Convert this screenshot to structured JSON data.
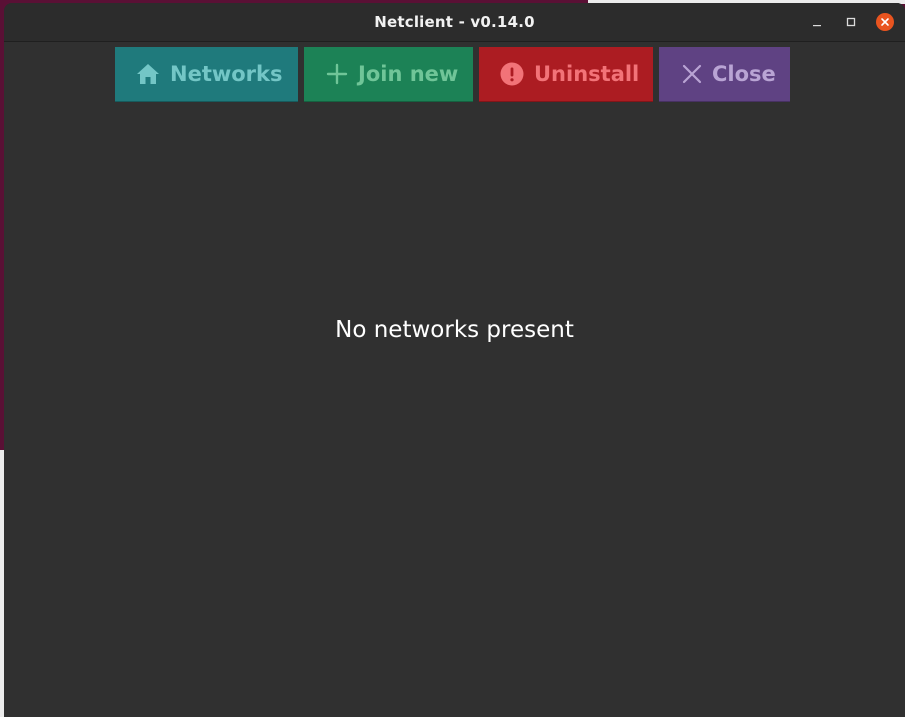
{
  "window": {
    "title": "Netclient - v0.14.0",
    "controls": {
      "minimize_icon": "minimize-icon",
      "maximize_icon": "maximize-icon",
      "close_icon": "close-icon",
      "close_color": "#e9541f"
    }
  },
  "toolbar": {
    "buttons": [
      {
        "label": "Networks",
        "icon": "home-icon",
        "bg": "#1f7a7c",
        "fg": "#73c6c6"
      },
      {
        "label": "Join new",
        "icon": "plus-icon",
        "bg": "#1c8256",
        "fg": "#70c598"
      },
      {
        "label": "Uninstall",
        "icon": "alert-circle-icon",
        "bg": "#ac1c22",
        "fg": "#f27378"
      },
      {
        "label": "Close",
        "icon": "x-icon",
        "bg": "#5f4283",
        "fg": "#b9a4d4"
      }
    ]
  },
  "main": {
    "empty_message": "No networks present"
  }
}
